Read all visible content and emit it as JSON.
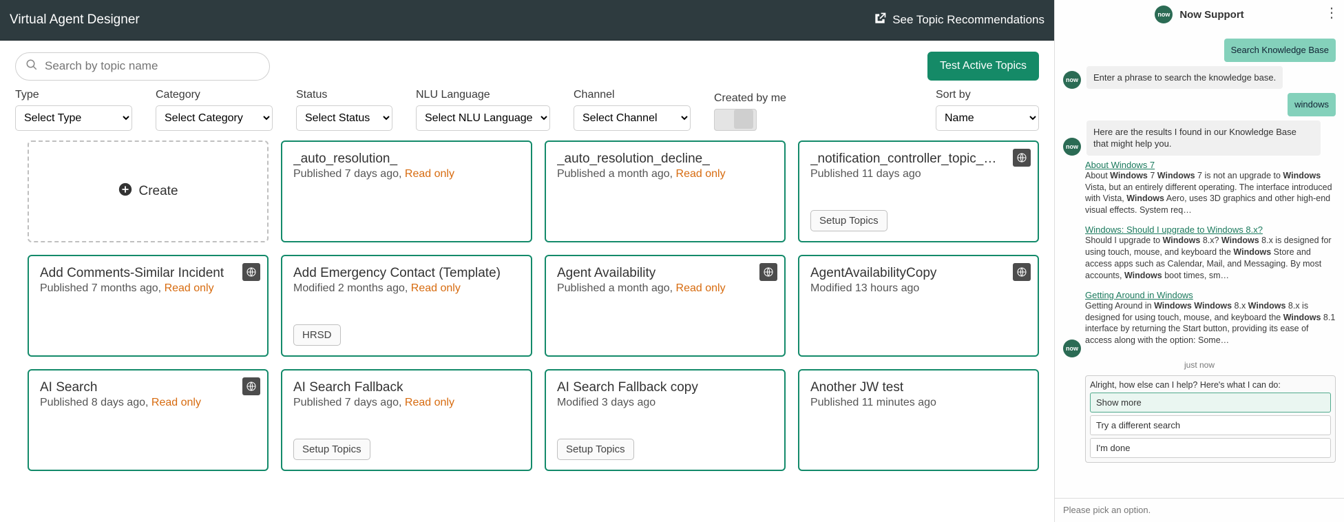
{
  "header": {
    "title": "Virtual Agent Designer",
    "see_recommendations": "See Topic Recommendations"
  },
  "toolbar": {
    "search_placeholder": "Search by topic name",
    "test_button": "Test Active Topics"
  },
  "filters": {
    "type": {
      "label": "Type",
      "placeholder": "Select Type"
    },
    "category": {
      "label": "Category",
      "placeholder": "Select Category"
    },
    "status": {
      "label": "Status",
      "placeholder": "Select Status"
    },
    "nlu": {
      "label": "NLU Language",
      "placeholder": "Select NLU Language"
    },
    "channel": {
      "label": "Channel",
      "placeholder": "Select Channel"
    },
    "created_by_me": {
      "label": "Created by me"
    },
    "sort_by": {
      "label": "Sort by",
      "value": "Name"
    }
  },
  "create_label": "Create",
  "read_only_label": "Read only",
  "topics": [
    {
      "title": "_auto_resolution_",
      "status": "Published",
      "age": "7 days ago,",
      "read_only": true,
      "icon": false,
      "tags": []
    },
    {
      "title": "_auto_resolution_decline_",
      "status": "Published",
      "age": "a month ago,",
      "read_only": true,
      "icon": false,
      "tags": []
    },
    {
      "title": "_notification_controller_topic_…",
      "status": "Published",
      "age": "11 days ago",
      "read_only": false,
      "icon": true,
      "tags": [
        "Setup Topics"
      ]
    },
    {
      "title": "Add Comments-Similar Incident",
      "status": "Published",
      "age": "7 months ago,",
      "read_only": true,
      "icon": true,
      "tags": []
    },
    {
      "title": "Add Emergency Contact (Template)",
      "status": "Modified",
      "age": "2 months ago,",
      "read_only": true,
      "icon": false,
      "tags": [
        "HRSD"
      ]
    },
    {
      "title": "Agent Availability",
      "status": "Published",
      "age": "a month ago,",
      "read_only": true,
      "icon": true,
      "tags": []
    },
    {
      "title": "AgentAvailabilityCopy",
      "status": "Modified",
      "age": "13 hours ago",
      "read_only": false,
      "icon": true,
      "tags": []
    },
    {
      "title": "AI Search",
      "status": "Published",
      "age": "8 days ago,",
      "read_only": true,
      "icon": true,
      "tags": []
    },
    {
      "title": "AI Search Fallback",
      "status": "Published",
      "age": "7 days ago,",
      "read_only": true,
      "icon": false,
      "tags": [
        "Setup Topics"
      ]
    },
    {
      "title": "AI Search Fallback copy",
      "status": "Modified",
      "age": "3 days ago",
      "read_only": false,
      "icon": false,
      "tags": [
        "Setup Topics"
      ]
    },
    {
      "title": "Another JW test",
      "status": "Published",
      "age": "11 minutes ago",
      "read_only": false,
      "icon": false,
      "tags": []
    }
  ],
  "chat": {
    "header_title": "Now Support",
    "user_msg_1": "Search Knowledge Base",
    "bot_msg_1": "Enter a phrase to search the knowledge base.",
    "user_msg_2": "windows",
    "results_intro": "Here are the results I found in our Knowledge Base that might help you.",
    "kb": [
      {
        "link": "About Windows 7",
        "snippet_html": "About <b>Windows</b> 7 <b>Windows</b> 7 is not an upgrade to <b>Windows</b> Vista, but an entirely different operating. The interface introduced with Vista, <b>Windows</b> Aero, uses 3D graphics and other high-end visual effects. System req…"
      },
      {
        "link": "Windows: Should I upgrade to Windows 8.x?",
        "snippet_html": "Should I upgrade to <b>Windows</b> 8.x? <b>Windows</b> 8.x is designed for using touch, mouse, and keyboard the <b>Windows</b> Store and access apps such as Calendar, Mail, and Messaging.  By most accounts, <b>Windows</b> boot times, sm…"
      },
      {
        "link": "Getting Around in Windows",
        "snippet_html": "Getting Around in <b>Windows Windows</b> 8.x <b>Windows</b> 8.x is designed for using touch, mouse, and keyboard the <b>Windows</b> 8.1 interface by returning the Start button, providing its ease of access along with the option: Some…"
      }
    ],
    "time_label": "just now",
    "followup_q": "Alright, how else can I help? Here's what I can do:",
    "options": [
      "Show more",
      "Try a different search",
      "I'm done"
    ],
    "input_placeholder": "Please pick an option."
  }
}
